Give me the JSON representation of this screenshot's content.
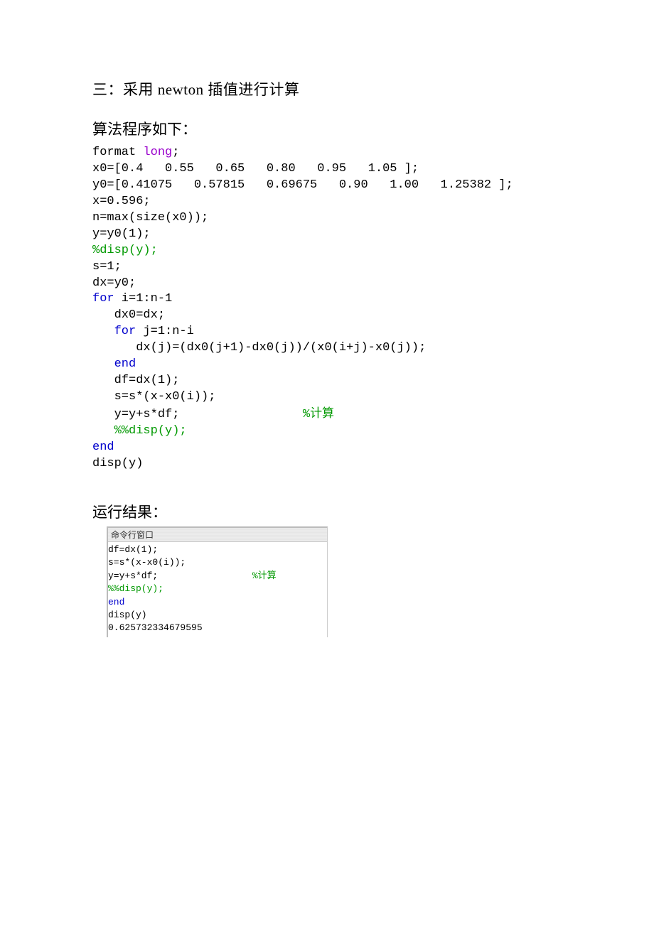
{
  "heading": {
    "prefix": "三：采用 ",
    "latin": "newton",
    "suffix": " 插值进行计算"
  },
  "sub1": "算法程序如下：",
  "code": {
    "l1a": "format ",
    "l1b": "long",
    "l1c": ";",
    "l2": "x0=[0.4   0.55   0.65   0.80   0.95   1.05 ];",
    "l3": "y0=[0.41075   0.57815   0.69675   0.90   1.00   1.25382 ];",
    "l4": "x=0.596;",
    "l5": "n=max(size(x0));",
    "l6": "y=y0(1);",
    "l7": "%disp(y);",
    "l8": "s=1;",
    "l9": "dx=y0;",
    "l10a": "for",
    "l10b": " i=1:n-1",
    "l11": "   dx0=dx;",
    "l12a": "   ",
    "l12b": "for",
    "l12c": " j=1:n-i",
    "l13": "      dx(j)=(dx0(j+1)-dx0(j))/(x0(i+j)-x0(j));",
    "l14a": "   ",
    "l14b": "end",
    "l15": "   df=dx(1);",
    "l16": "   s=s*(x-x0(i));",
    "l17a": "   y=y+s*df;                 ",
    "l17b": "%",
    "l17c": "计算",
    "l18a": "   ",
    "l18b": "%%disp(y);",
    "l19": "end",
    "l20": "disp(y)"
  },
  "sub2": "运行结果：",
  "cmd": {
    "title": "命令行窗口",
    "r1": "df=dx(1);",
    "r2": "s=s*(x-x0(i));",
    "r3a": "y=y+s*df;                 ",
    "r3b": "%",
    "r3c": "计算",
    "r4": "%%disp(y);",
    "r5": "end",
    "r6": "disp(y)",
    "r7": "0.625732334679595"
  }
}
